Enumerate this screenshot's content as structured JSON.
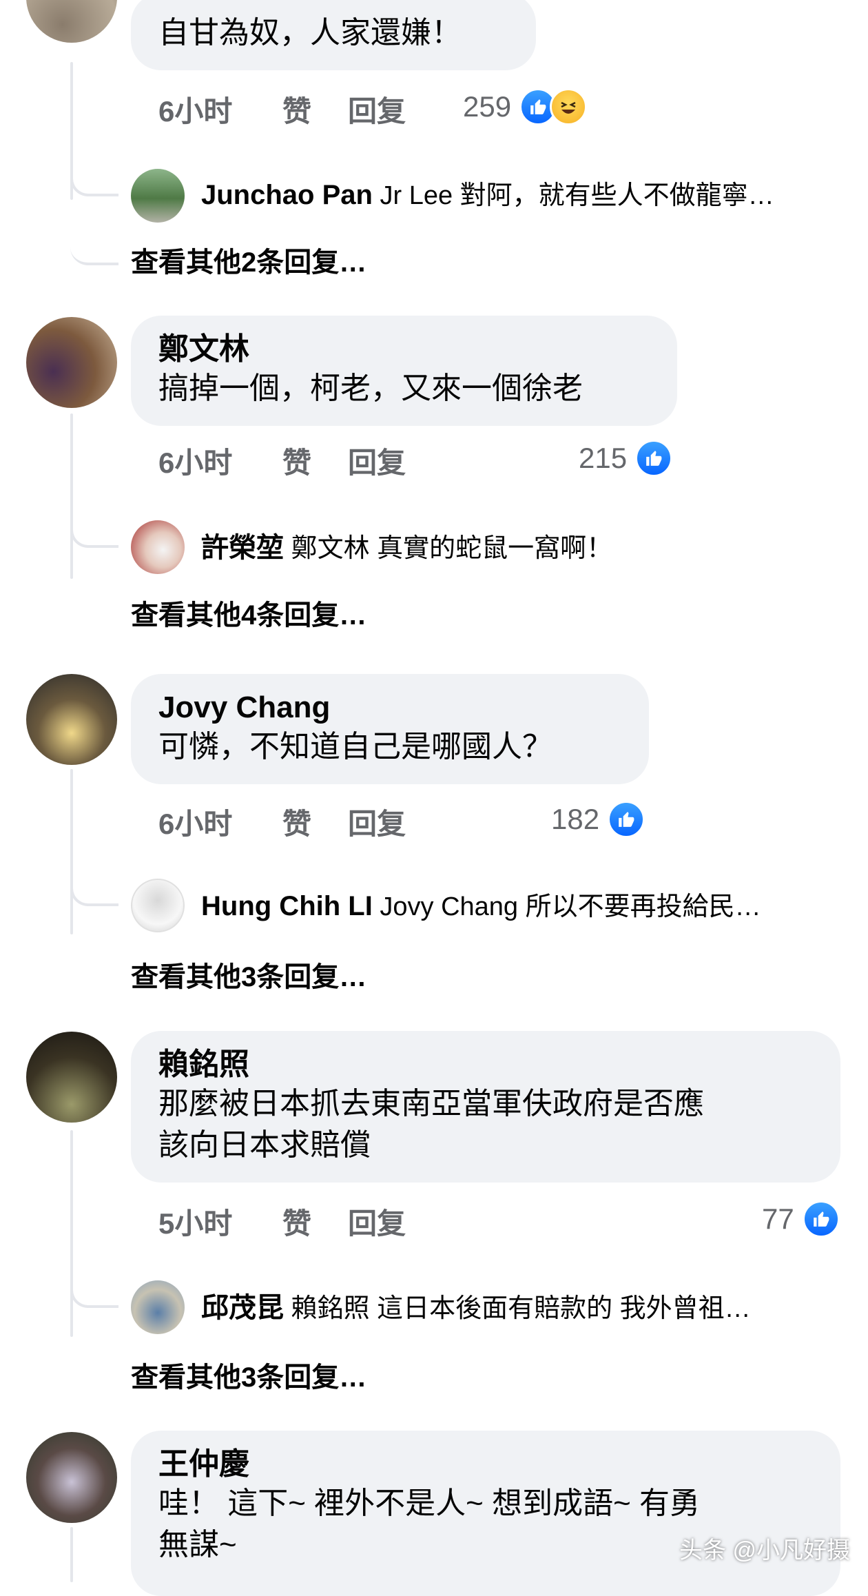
{
  "comments": [
    {
      "text": "自甘為奴，人家還嫌！",
      "time": "6小时",
      "like": "赞",
      "reply": "回复",
      "reaction_count": "259",
      "reply_preview": {
        "name": "Junchao Pan",
        "text": "Jr Lee 對阿，就有些人不做龍寧…"
      },
      "see_more": "查看其他2条回复…"
    },
    {
      "author": "鄭文林",
      "text": "搞掉一個，柯老，又來一個徐老",
      "time": "6小时",
      "like": "赞",
      "reply": "回复",
      "reaction_count": "215",
      "reply_preview": {
        "name": "許榮堃",
        "text": "鄭文林 真實的蛇鼠一窩啊！"
      },
      "see_more": "查看其他4条回复…"
    },
    {
      "author": "Jovy Chang",
      "text": "可憐，不知道自己是哪國人？",
      "time": "6小时",
      "like": "赞",
      "reply": "回复",
      "reaction_count": "182",
      "reply_preview": {
        "name": "Hung Chih LI",
        "text": "Jovy Chang 所以不要再投給民…"
      },
      "see_more": "查看其他3条回复…"
    },
    {
      "author": "賴銘照",
      "text_line1": "那麼被日本抓去東南亞當軍伕政府是否應",
      "text_line2": "該向日本求賠償",
      "time": "5小时",
      "like": "赞",
      "reply": "回复",
      "reaction_count": "77",
      "reply_preview": {
        "name": "邱茂昆",
        "text": "賴銘照 這日本後面有賠款的 我外曾祖…"
      },
      "see_more": "查看其他3条回复…"
    },
    {
      "author": "王仲慶",
      "text_line1": "哇！ 這下~ 裡外不是人~ 想到成語~ 有勇",
      "text_line2": "無謀~"
    }
  ],
  "watermark": "头条 @小凡好摄",
  "colors": {
    "bubble": "#f0f2f5",
    "meta": "#65676b",
    "like_blue": "#0866ff",
    "line": "#e4e6eb"
  }
}
